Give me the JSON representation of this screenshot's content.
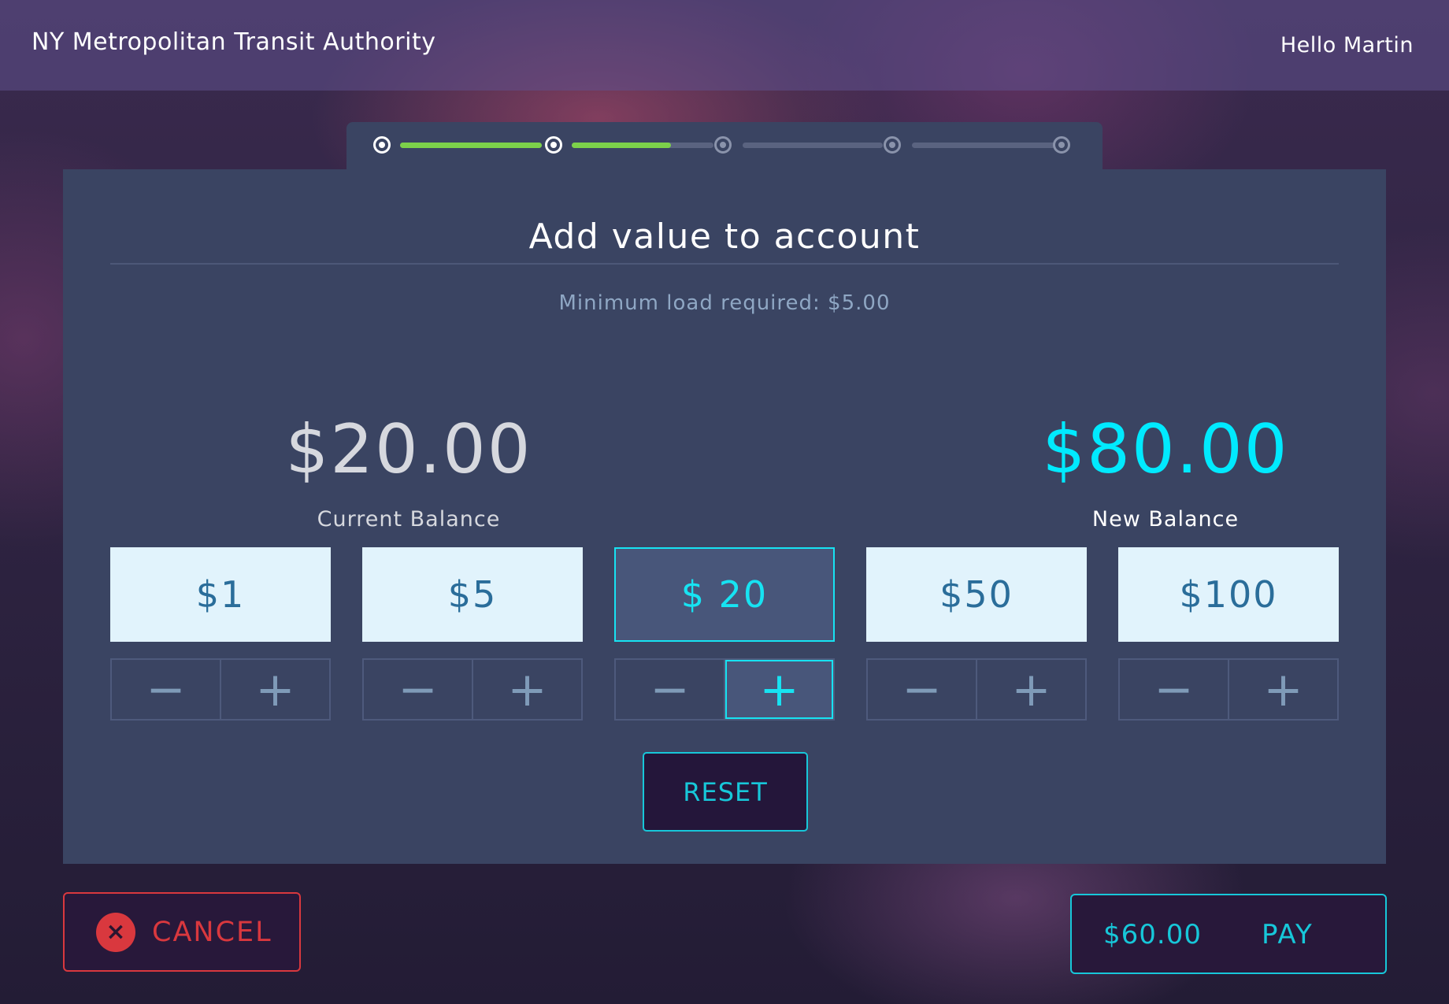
{
  "header": {
    "org_name": "NY Metropolitan Transit Authority",
    "greeting": "Hello Martin"
  },
  "progress": {
    "total_steps": 5,
    "completed_fraction": 0.54,
    "segment_fills": [
      1.0,
      0.7,
      0.0,
      0.0
    ]
  },
  "panel": {
    "title": "Add value to account",
    "subtitle": "Minimum load required: $5.00"
  },
  "balances": {
    "current_amount": "$20.00",
    "current_label": "Current Balance",
    "new_amount": "$80.00",
    "new_label": "New Balance"
  },
  "denominations": [
    {
      "label": "$1",
      "selected": false
    },
    {
      "label": "$5",
      "selected": false
    },
    {
      "label": "$ 20",
      "selected": true
    },
    {
      "label": "$50",
      "selected": false
    },
    {
      "label": "$100",
      "selected": false
    }
  ],
  "stepper": {
    "minus_symbol": "−",
    "plus_symbol": "+"
  },
  "actions": {
    "reset_label": "RESET",
    "cancel_label": "CANCEL",
    "cancel_icon": "×",
    "pay_total": "$60.00",
    "pay_label": "PAY"
  },
  "colors": {
    "accent": "#17e3f2",
    "danger": "#d9383e",
    "progress_green": "#7cd14a"
  }
}
